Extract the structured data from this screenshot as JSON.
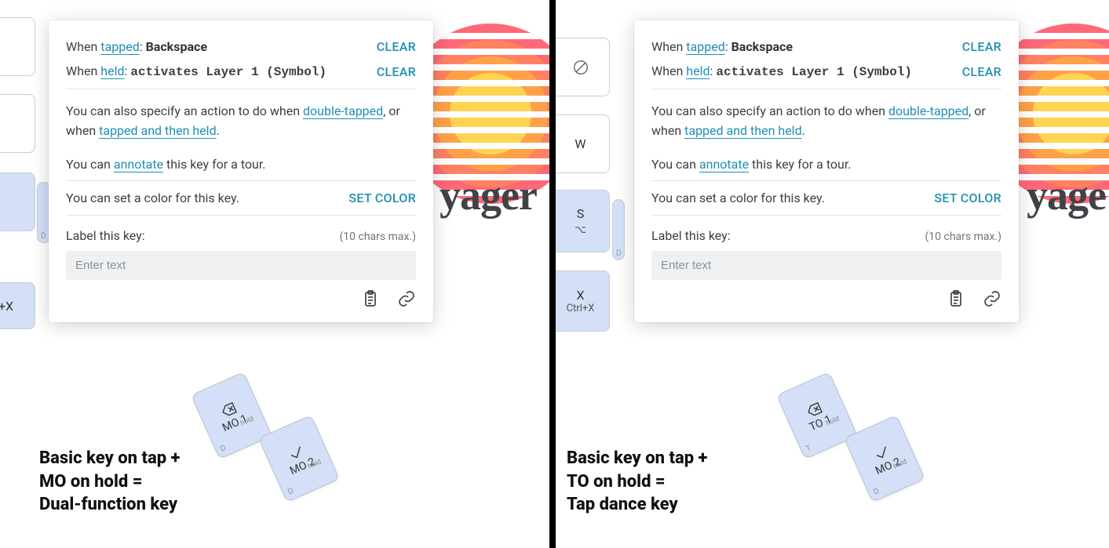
{
  "brand_fragment_left": "yager",
  "brand_fragment_right": "yage",
  "popover": {
    "tapped_label": "tapped",
    "tapped_prefix": "When ",
    "tapped_suffix": ": ",
    "tapped_value": "Backspace",
    "held_label": "held",
    "held_prefix": "When ",
    "held_suffix": ": ",
    "held_value": "activates Layer 1 (Symbol)",
    "clear": "CLEAR",
    "extra_prefix": "You can also specify an action to do when ",
    "double_tapped": "double-tapped",
    "extra_mid": ", or when ",
    "tapped_then_held": "tapped and then held",
    "extra_end": ".",
    "annotate_prefix": "You can ",
    "annotate": "annotate",
    "annotate_suffix": " this key for a tour.",
    "color_text": "You can set a color for this key.",
    "set_color": "SET COLOR",
    "label_this_key": "Label this key:",
    "chars_max": "(10 chars max.)",
    "placeholder": "Enter text"
  },
  "bgkeys": {
    "plusX": "+X",
    "W": "W",
    "S": "S",
    "X": "X",
    "CtrlX": "Ctrl+X",
    "D": "D"
  },
  "thumbs": {
    "left1": "MO 1",
    "left2": "MO 2",
    "right1": "TO 1",
    "right2": "MO 2",
    "hold": "hold",
    "D": "D",
    "T": "T"
  },
  "captions": {
    "left_l1": "Basic key on tap +",
    "left_l2": "MO on hold =",
    "left_l3": "Dual-function key",
    "right_l1": "Basic key on tap +",
    "right_l2": "TO on hold =",
    "right_l3": "Tap dance key"
  }
}
